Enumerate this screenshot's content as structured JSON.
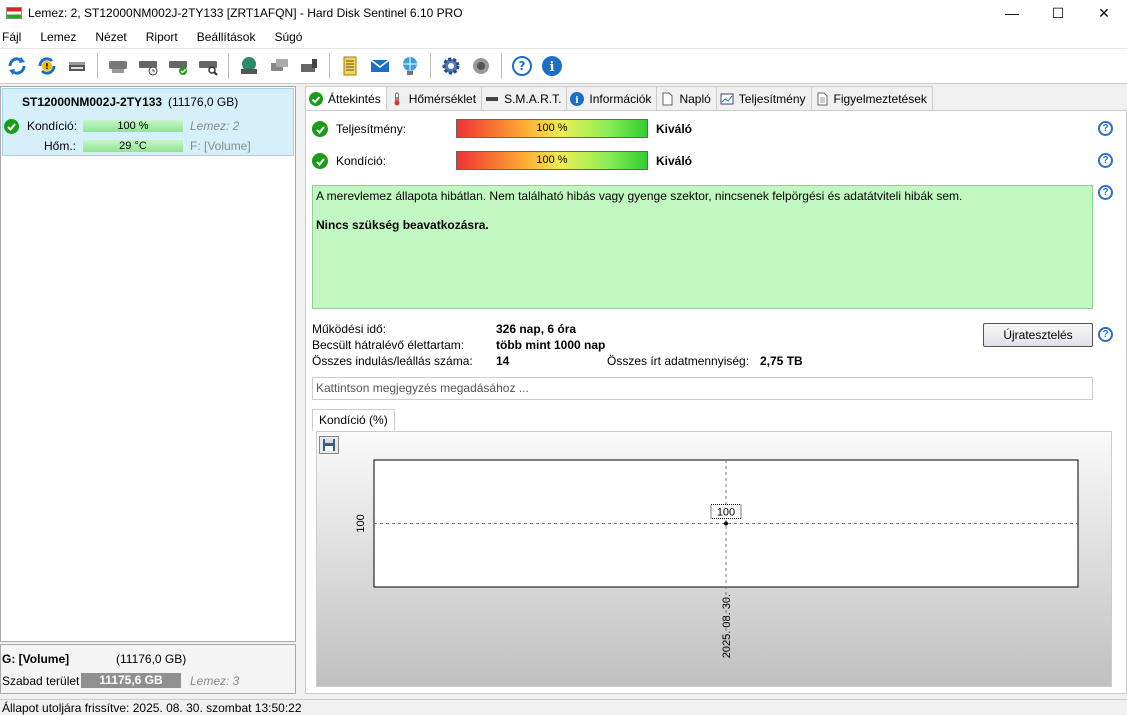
{
  "window": {
    "title": "Lemez: 2, ST12000NM002J-2TY133 [ZRT1AFQN]  -  Hard Disk Sentinel 6.10 PRO"
  },
  "menu": [
    "Fájl",
    "Lemez",
    "Nézet",
    "Riport",
    "Beállítások",
    "Súgó"
  ],
  "disk": {
    "name": "ST12000NM002J-2TY133",
    "size": "(11176,0 GB)",
    "health_label": "Kondíció:",
    "health_value": "100 %",
    "disk_label": "Lemez: 2",
    "temp_label": "Hőm.:",
    "temp_value": "29 °C",
    "volume_label": "F: [Volume]"
  },
  "volume": {
    "name": "G: [Volume]",
    "size": "(11176,0 GB)",
    "free_label": "Szabad terület",
    "free_value": "11175,6 GB",
    "disk_ref": "Lemez: 3"
  },
  "tabs": [
    "Áttekintés",
    "Hőmérséklet",
    "S.M.A.R.T.",
    "Információk",
    "Napló",
    "Teljesítmény",
    "Figyelmeztetések"
  ],
  "overview": {
    "performance_label": "Teljesítmény:",
    "performance_value": "100 %",
    "performance_fraction": 1.0,
    "performance_text": "Kiváló",
    "health_label": "Kondíció:",
    "health_value": "100 %",
    "health_fraction": 1.0,
    "health_text": "Kiváló",
    "status_text": "A merevlemez állapota hibátlan. Nem található hibás vagy gyenge szektor, nincsenek felpörgési és adatátviteli hibák sem.",
    "status_action": "Nincs szükség beavatkozásra.",
    "uptime_label": "Működési idő:",
    "uptime_value": "326 nap, 6 óra",
    "lifetime_label": "Becsült hátralévő élettartam:",
    "lifetime_value": "több mint 1000 nap",
    "starts_label": "Összes indulás/leállás száma:",
    "starts_value": "14",
    "written_label": "Összes írt adatmennyiség:",
    "written_value": "2,75 TB",
    "retest_button": "Újratesztelés",
    "note_placeholder": "Kattintson megjegyzés megadásához ..."
  },
  "chart_tab": "Kondíció  (%)",
  "chart_data": {
    "type": "line",
    "x": [
      "2025. 08. 30."
    ],
    "values": [
      100
    ],
    "point_label": "100",
    "y_tick": "100",
    "x_tick": "2025. 08. 30.",
    "grid": true
  },
  "statusbar": {
    "text": "Állapot utoljára frissítve: 2025. 08. 30. szombat 13:50:22"
  },
  "colors": {
    "selection": "#d6f0fb",
    "ok_green": "#c2f7c2",
    "help_blue": "#2a6fc9"
  }
}
